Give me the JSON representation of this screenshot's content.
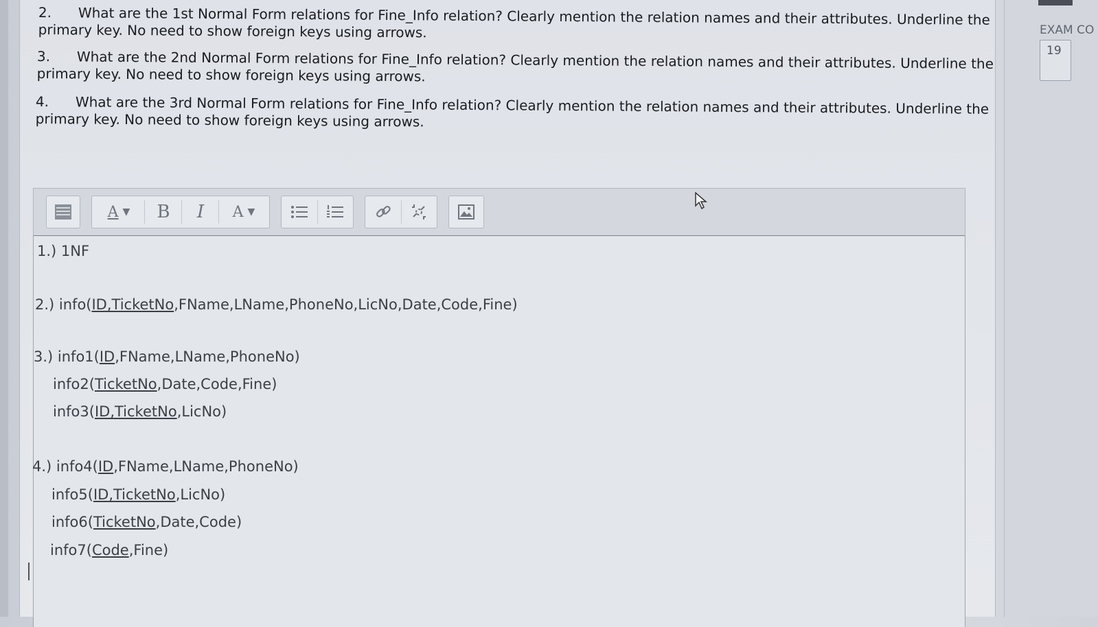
{
  "questions": [
    {
      "num": "2.",
      "line1": "What are the 1st Normal Form relations for Fine_Info relation? Clearly mention the relation names and their attributes. Underline the",
      "line2": "primary key. No need to show foreign keys using arrows."
    },
    {
      "num": "3.",
      "line1": "What are the 2nd Normal Form relations for Fine_Info relation? Clearly mention the relation names and their attributes. Underline the",
      "line2": "primary key. No need to show foreign keys using arrows."
    },
    {
      "num": "4.",
      "line1": "What are the 3rd Normal Form relations for Fine_Info relation? Clearly mention the relation names and their attributes. Underline the",
      "line2": "primary key. No need to show foreign keys using arrows."
    }
  ],
  "sidebar": {
    "label": "EXAM CO",
    "value": "19"
  },
  "toolbar": {
    "format_glyph": "A",
    "bold": "B",
    "italic": "I",
    "color_glyph": "A"
  },
  "answer": {
    "a1": "1.) 1NF",
    "a2_pre": "2.) info(",
    "a2_pk": "ID,TicketNo",
    "a2_post": ",FName,LName,PhoneNo,LicNo,Date,Code,Fine)",
    "a3_1_pre": "3.) info1(",
    "a3_1_pk": "ID",
    "a3_1_post": ",FName,LName,PhoneNo)",
    "a3_2_pre": "info2(",
    "a3_2_pk": "TicketNo",
    "a3_2_post": ",Date,Code,Fine)",
    "a3_3_pre": "info3(",
    "a3_3_pk": "ID,TicketNo",
    "a3_3_post": ",LicNo)",
    "a4_1_pre": "4.) info4(",
    "a4_1_pk": "ID",
    "a4_1_post": ",FName,LName,PhoneNo)",
    "a4_2_pre": "info5(",
    "a4_2_pk": "ID,TicketNo",
    "a4_2_post": ",LicNo)",
    "a4_3_pre": "info6(",
    "a4_3_pk": "TicketNo",
    "a4_3_post": ",Date,Code)",
    "a4_4_pre": "info7(",
    "a4_4_pk": "Code",
    "a4_4_post": ",Fine)"
  }
}
